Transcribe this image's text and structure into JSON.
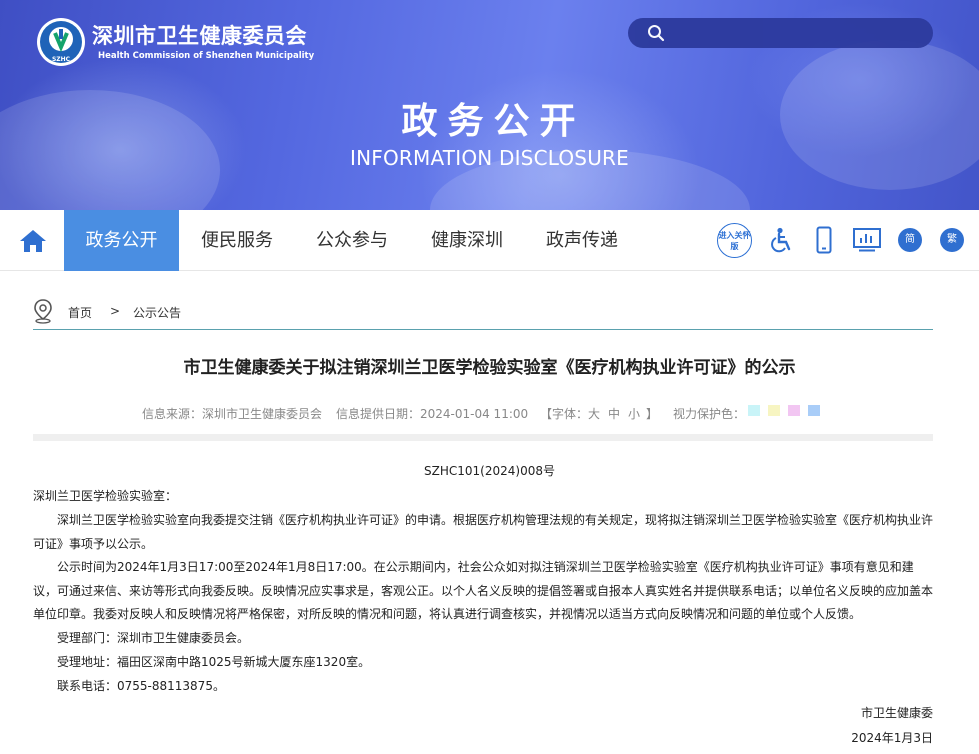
{
  "header": {
    "org_name_cn": "深圳市卫生健康委员会",
    "org_name_en": "Health Commission of Shenzhen Municipality",
    "logo_text": "SZHC",
    "banner_title": "政务公开",
    "banner_subtitle": "INFORMATION DISCLOSURE",
    "search": {
      "placeholder": ""
    }
  },
  "nav": {
    "items": [
      "政务公开",
      "便民服务",
      "公众参与",
      "健康深圳",
      "政声传递"
    ],
    "active_index": 0,
    "tools": {
      "elderly_mode": "进入关怀版",
      "simplified": "简",
      "traditional": "繁"
    }
  },
  "breadcrumb": {
    "home": "首页",
    "separator": ">",
    "current": "公示公告"
  },
  "article": {
    "title": "市卫生健康委关于拟注销深圳兰卫医学检验实验室《医疗机构执业许可证》的公示",
    "meta": {
      "source": "信息来源：深圳市卫生健康委员会",
      "date": "信息提供日期：2024-01-04 11:00",
      "font_size_label": "【字体：",
      "font_large": "大",
      "font_medium": "中",
      "font_small": "小",
      "font_close": "】",
      "eye_protection_label": "视力保护色：",
      "eye_colors": [
        "#c9f4f8",
        "#f7f5c2",
        "#f2c6f2",
        "#a9cdf8"
      ]
    },
    "doc_number": "SZHC101(2024)008号",
    "salutation": "深圳兰卫医学检验实验室：",
    "paragraph_1": "深圳兰卫医学检验实验室向我委提交注销《医疗机构执业许可证》的申请。根据医疗机构管理法规的有关规定，现将拟注销深圳兰卫医学检验实验室《医疗机构执业许可证》事项予以公示。",
    "paragraph_2": "公示时间为2024年1月3日17:00至2024年1月8日17:00。在公示期间内，社会公众如对拟注销深圳兰卫医学检验实验室《医疗机构执业许可证》事项有意见和建议，可通过来信、来访等形式向我委反映。反映情况应实事求是，客观公正。以个人名义反映的提倡签署或自报本人真实姓名并提供联系电话；以单位名义反映的应加盖本单位印章。我委对反映人和反映情况将严格保密，对所反映的情况和问题，将认真进行调查核实，并视情况以适当方式向反映情况和问题的单位或个人反馈。",
    "dept": "受理部门：深圳市卫生健康委员会。",
    "address": "受理地址：福田区深南中路1025号新城大厦东座1320室。",
    "phone": "联系电话：0755-88113875。",
    "signature": "市卫生健康委",
    "sign_date": "2024年1月3日"
  }
}
